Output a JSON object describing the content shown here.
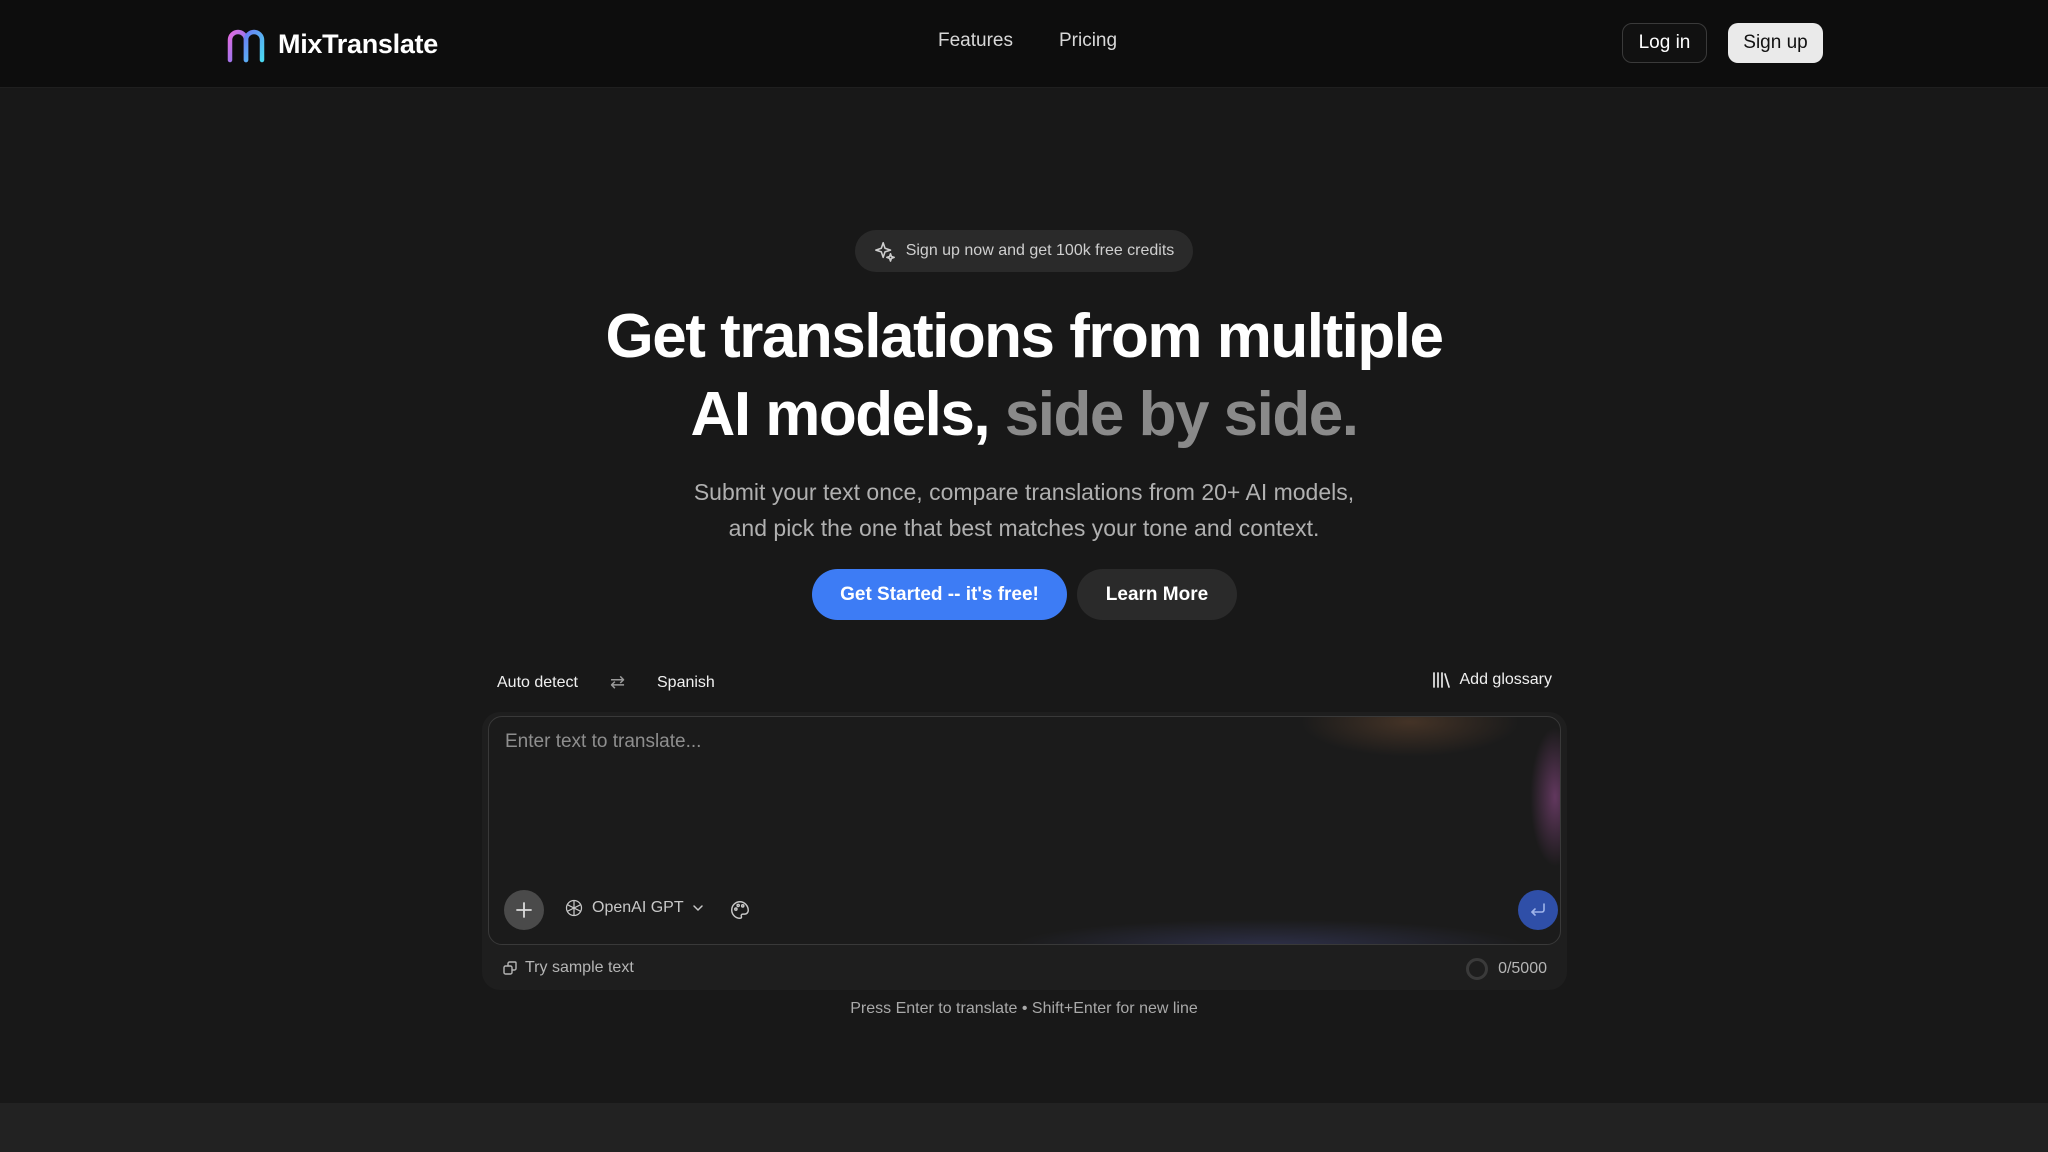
{
  "header": {
    "brand_name": "MixTranslate",
    "nav": [
      "Features",
      "Pricing"
    ],
    "login_label": "Log in",
    "signup_label": "Sign up"
  },
  "hero": {
    "badge": "Sign up now and get 100k free credits",
    "headline_line1": "Get translations from multiple",
    "headline_line2_main": "AI models, ",
    "headline_line2_muted": "side by side.",
    "subtitle_line1": "Submit your text once, compare translations from 20+ AI models,",
    "subtitle_line2": "and pick the one that best matches your tone and context.",
    "primary_cta": "Get Started -- it's free!",
    "secondary_cta": "Learn More"
  },
  "translator": {
    "source_language": "Auto detect",
    "target_language": "Spanish",
    "glossary_label": "Add glossary",
    "placeholder": "Enter text to translate...",
    "model": "OpenAI GPT",
    "sample_label": "Try sample text",
    "char_count": "0/5000",
    "hint": "Press Enter to translate • Shift+Enter for new line"
  },
  "colors": {
    "accent": "#3d7cf5",
    "send_button": "#2f4fa8",
    "background": "#181818",
    "header": "#0d0d0d"
  },
  "icons": [
    "logo-icon",
    "sparkle-icon",
    "swap-icon",
    "library-icon",
    "plus-icon",
    "openai-icon",
    "chevron-down-icon",
    "palette-icon",
    "enter-icon",
    "sample-icon"
  ]
}
